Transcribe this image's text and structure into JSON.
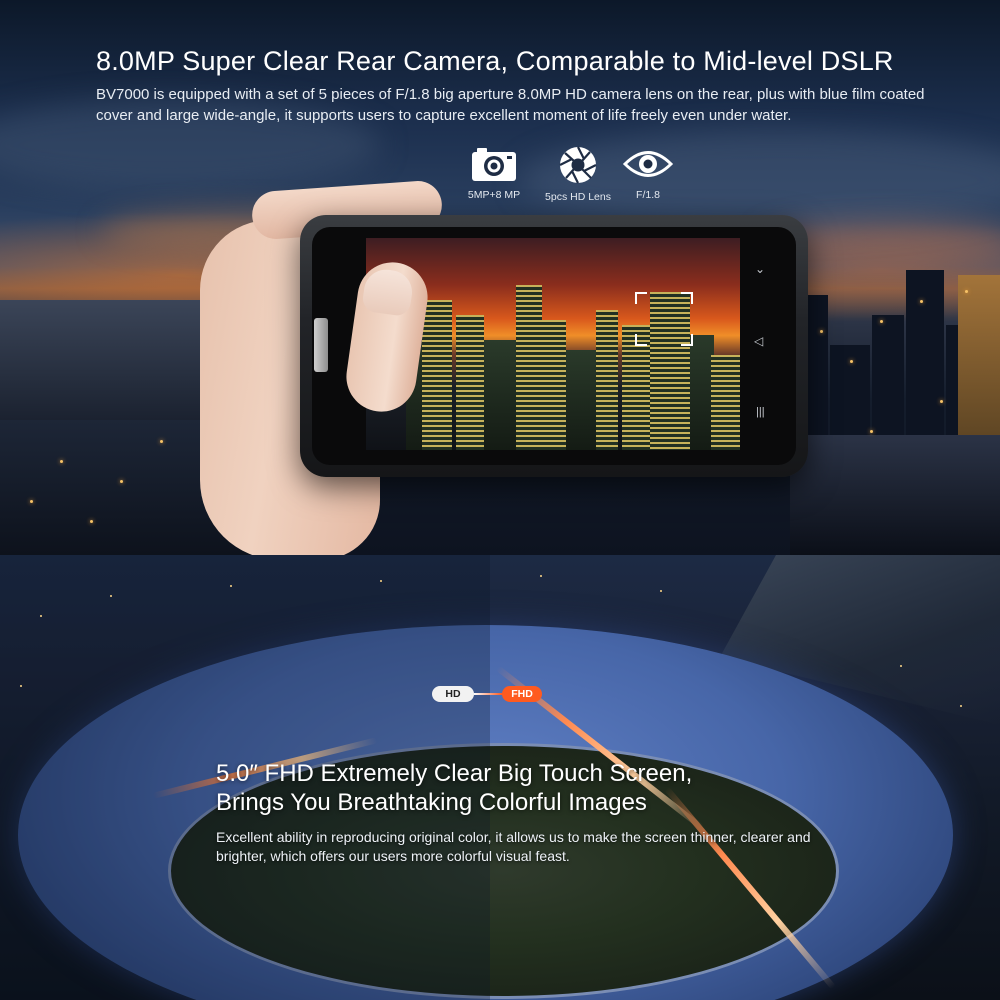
{
  "camera_section": {
    "title": "8.0MP Super Clear Rear Camera, Comparable to Mid-level DSLR",
    "description": "BV7000 is equipped with a set of 5 pieces of F/1.8 big aperture 8.0MP HD camera lens on the rear, plus with blue film coated cover and large wide-angle, it supports users to capture excellent moment of life freely even under water.",
    "features": [
      {
        "icon": "camera-icon",
        "label": "5MP+8 MP"
      },
      {
        "icon": "aperture-icon",
        "label": "5pcs HD Lens"
      },
      {
        "icon": "eye-icon",
        "label": "F/1.8"
      }
    ]
  },
  "phone_nav": {
    "icons": [
      "chevron-down-icon",
      "back-icon",
      "menu-icon"
    ]
  },
  "screen_section": {
    "hd_label": "HD",
    "fhd_label": "FHD",
    "title_line1": "5.0″ FHD Extremely Clear Big Touch Screen,",
    "title_line2": "Brings You Breathtaking Colorful Images",
    "description": "Excellent ability in reproducing original color, it allows us to make the screen thinner, clearer and brighter, which offers our users more colorful visual feast."
  },
  "colors": {
    "fhd_accent": "#ff5a1f",
    "hd_pill": "#f2f2f2"
  }
}
